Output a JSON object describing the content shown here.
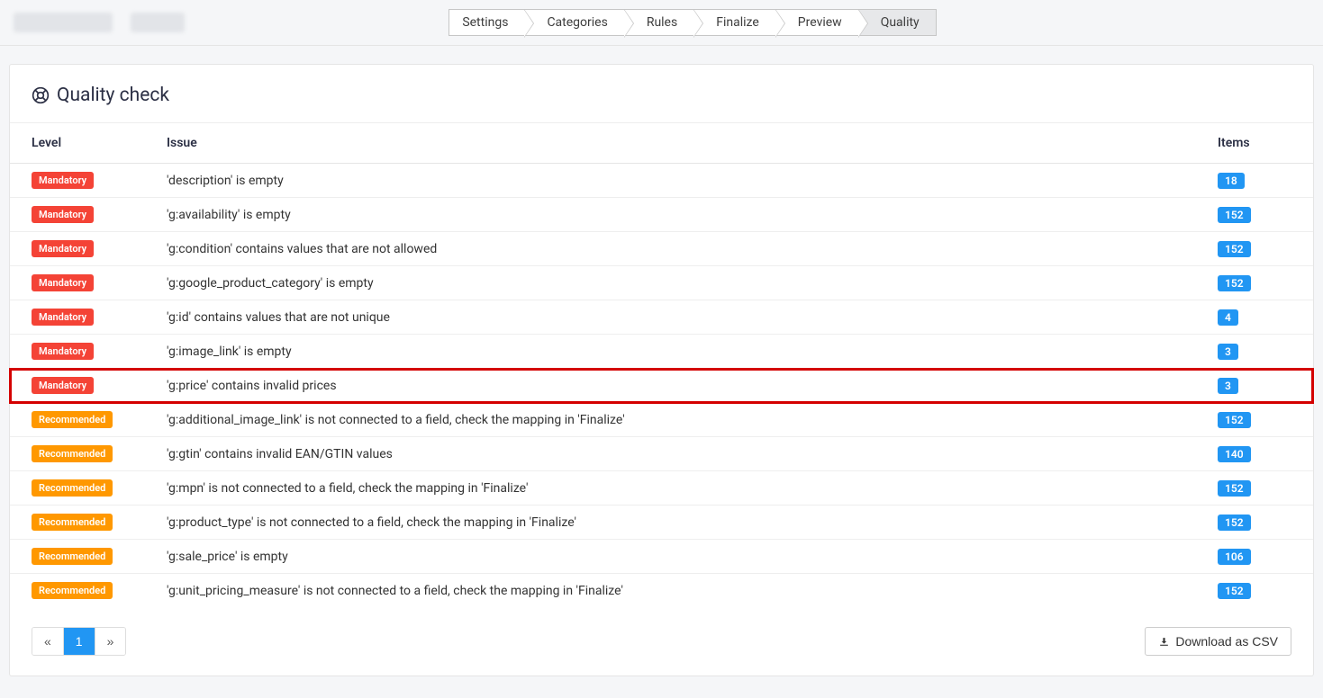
{
  "wizard": {
    "steps": [
      {
        "label": "Settings"
      },
      {
        "label": "Categories"
      },
      {
        "label": "Rules"
      },
      {
        "label": "Finalize"
      },
      {
        "label": "Preview"
      },
      {
        "label": "Quality",
        "active": true
      }
    ]
  },
  "panel": {
    "title": "Quality check"
  },
  "table": {
    "headers": {
      "level": "Level",
      "issue": "Issue",
      "items": "Items"
    },
    "level_labels": {
      "mandatory": "Mandatory",
      "recommended": "Recommended"
    },
    "rows": [
      {
        "level": "mandatory",
        "issue": "'description' is empty",
        "items": 18
      },
      {
        "level": "mandatory",
        "issue": "'g:availability' is empty",
        "items": 152
      },
      {
        "level": "mandatory",
        "issue": "'g:condition' contains values that are not allowed",
        "items": 152
      },
      {
        "level": "mandatory",
        "issue": "'g:google_product_category' is empty",
        "items": 152
      },
      {
        "level": "mandatory",
        "issue": "'g:id' contains values that are not unique",
        "items": 4
      },
      {
        "level": "mandatory",
        "issue": "'g:image_link' is empty",
        "items": 3
      },
      {
        "level": "mandatory",
        "issue": "'g:price' contains invalid prices",
        "items": 3,
        "highlighted": true
      },
      {
        "level": "recommended",
        "issue": "'g:additional_image_link' is not connected to a field, check the mapping in 'Finalize'",
        "items": 152
      },
      {
        "level": "recommended",
        "issue": "'g:gtin' contains invalid EAN/GTIN values",
        "items": 140
      },
      {
        "level": "recommended",
        "issue": "'g:mpn' is not connected to a field, check the mapping in 'Finalize'",
        "items": 152
      },
      {
        "level": "recommended",
        "issue": "'g:product_type' is not connected to a field, check the mapping in 'Finalize'",
        "items": 152
      },
      {
        "level": "recommended",
        "issue": "'g:sale_price' is empty",
        "items": 106
      },
      {
        "level": "recommended",
        "issue": "'g:unit_pricing_measure' is not connected to a field, check the mapping in 'Finalize'",
        "items": 152
      }
    ]
  },
  "pagination": {
    "prev": "«",
    "pages": [
      "1"
    ],
    "next": "»",
    "active": "1"
  },
  "footer": {
    "download_label": "Download as CSV"
  }
}
